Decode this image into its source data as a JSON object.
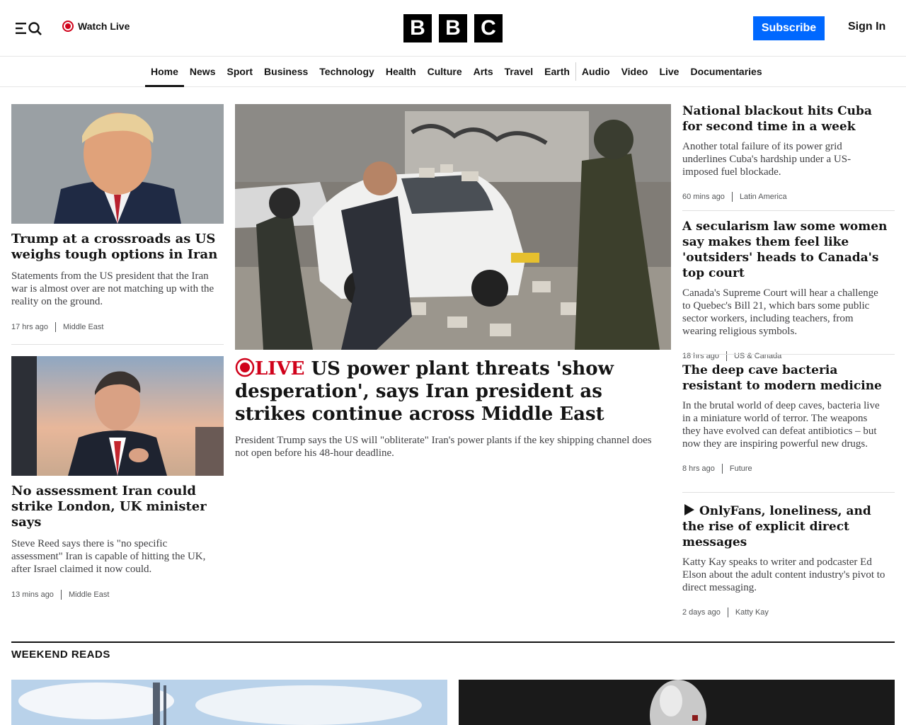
{
  "header": {
    "watch_live": "Watch Live",
    "logo_letters": [
      "B",
      "B",
      "C"
    ],
    "subscribe": "Subscribe",
    "sign_in": "Sign In"
  },
  "nav": {
    "items": [
      "Home",
      "News",
      "Sport",
      "Business",
      "Technology",
      "Health",
      "Culture",
      "Arts",
      "Travel",
      "Earth",
      "Audio",
      "Video",
      "Live",
      "Documentaries"
    ],
    "active": "Home"
  },
  "left": [
    {
      "headline": "Trump at a crossroads as US weighs tough options in Iran",
      "summary": "Statements from the US president that the Iran war is almost over are not matching up with the reality on the ground.",
      "time": "17 hrs ago",
      "section": "Middle East"
    },
    {
      "headline": "No assessment Iran could strike London, UK minister says",
      "summary": "Steve Reed says there is \"no specific assessment\" Iran is capable of hitting the UK, after Israel claimed it now could.",
      "time": "13 mins ago",
      "section": "Middle East"
    }
  ],
  "center": {
    "live_label": "LIVE",
    "headline": "US power plant threats 'show desperation', says Iran president as strikes continue across Middle East",
    "summary": "President Trump says the US will \"obliterate\" Iran's power plants if the key shipping channel does not open before his 48-hour deadline."
  },
  "right": [
    {
      "headline": "National blackout hits Cuba for second time in a week",
      "summary": "Another total failure of its power grid underlines Cuba's hardship under a US-imposed fuel blockade.",
      "time": "60 mins ago",
      "section": "Latin America"
    },
    {
      "headline": "A secularism law some women say makes them feel like 'outsiders' heads to Canada's top court",
      "summary": "Canada's Supreme Court will hear a challenge to Quebec's Bill 21, which bars some public sector workers, including teachers, from wearing religious symbols.",
      "time": "18 hrs ago",
      "section": "US & Canada"
    },
    {
      "headline": "The deep cave bacteria resistant to modern medicine",
      "summary": "In the brutal world of deep caves, bacteria live in a miniature world of terror. The weapons they have evolved can defeat antibiotics – but now they are inspiring powerful new drugs.",
      "time": "8 hrs ago",
      "section": "Future"
    },
    {
      "headline": "OnlyFans, loneliness, and the rise of explicit direct messages",
      "summary": "Katty Kay speaks to writer and podcaster Ed Elson about the adult content industry's pivot to direct messaging.",
      "time": "2 days ago",
      "section": "Katty Kay"
    }
  ],
  "weekend": {
    "title": "WEEKEND READS"
  },
  "colors": {
    "live_red": "#d0021b",
    "subscribe_blue": "#0068ff"
  }
}
